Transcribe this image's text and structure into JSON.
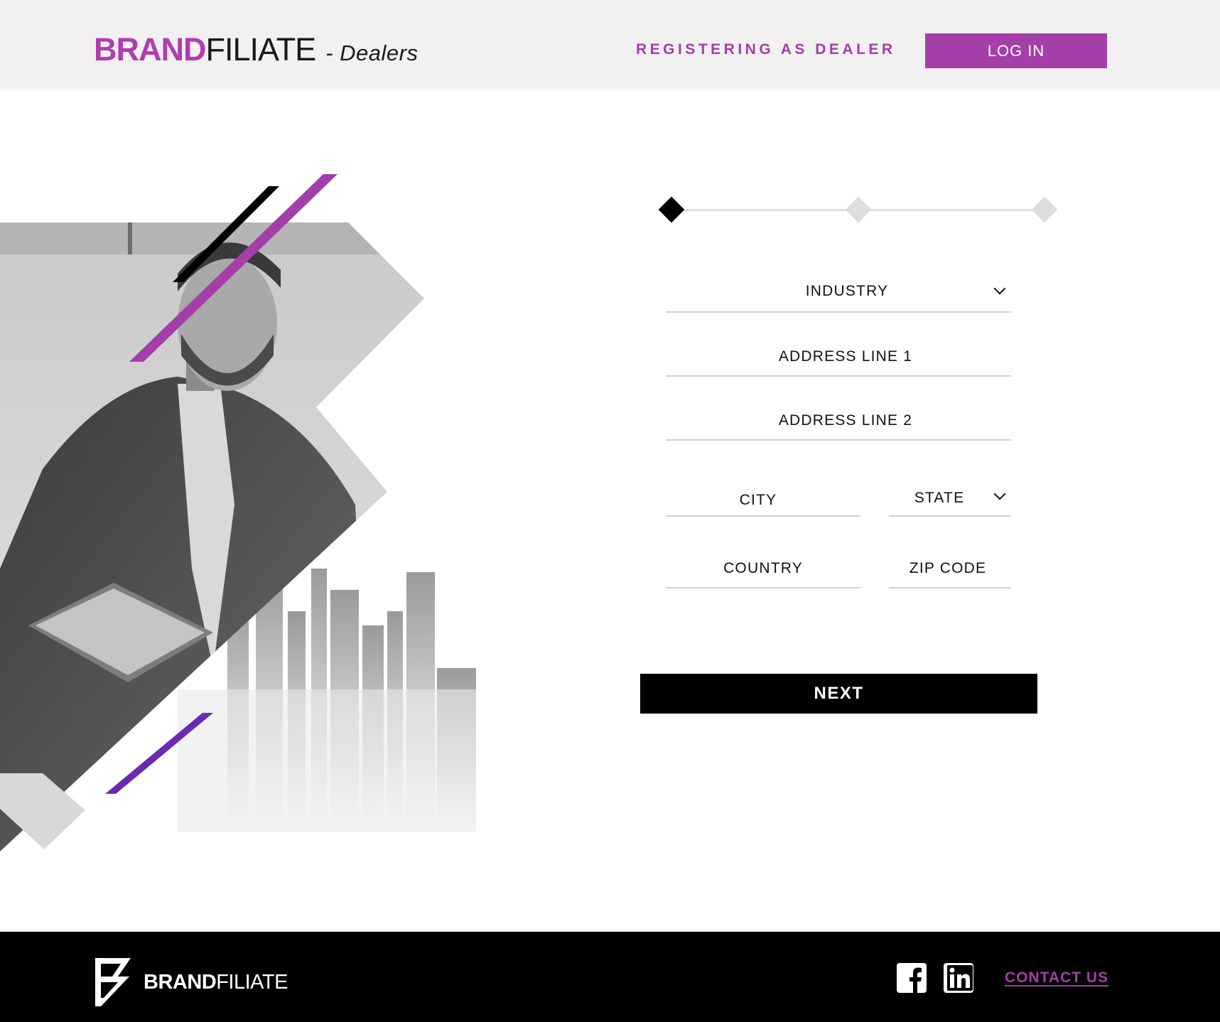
{
  "header": {
    "logo_brand": "BRAND",
    "logo_filiate": "FILIATE",
    "logo_sub": "- Dealers",
    "registering_label": "REGISTERING AS DEALER",
    "login_label": "LOG IN"
  },
  "stepper": {
    "current_step": 1,
    "total_steps": 3
  },
  "form": {
    "industry": "INDUSTRY",
    "address_line_1": "ADDRESS LINE 1",
    "address_line_2": "ADDRESS LINE 2",
    "city": "CITY",
    "state": "STATE",
    "country": "COUNTRY",
    "zip_code": "ZIP CODE",
    "next_label": "NEXT"
  },
  "footer": {
    "logo_brand": "BRAND",
    "logo_filiate": "FILIATE",
    "social": [
      {
        "icon": "facebook-icon"
      },
      {
        "icon": "linkedin-icon"
      }
    ],
    "contact_label": "CONTACT US"
  },
  "colors": {
    "accent": "#a43ea8",
    "header_bg": "#f2f0f1",
    "footer_bg": "#000000",
    "button_dark": "#000000"
  }
}
